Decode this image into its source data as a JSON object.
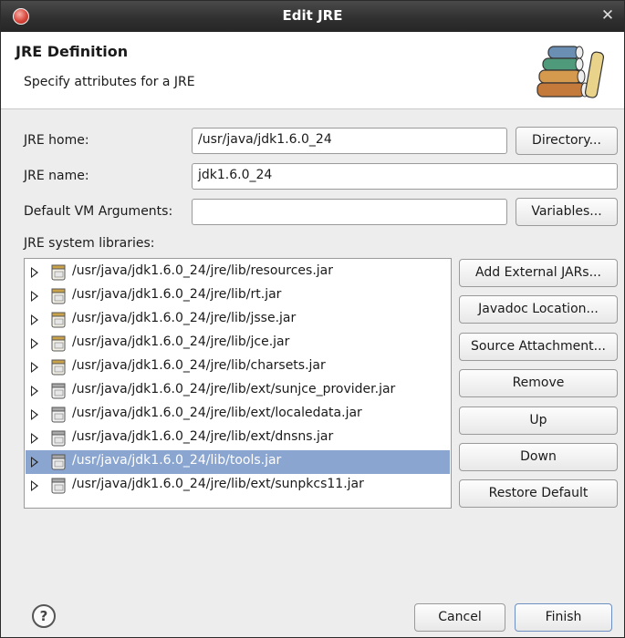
{
  "window": {
    "title": "Edit JRE"
  },
  "header": {
    "heading": "JRE Definition",
    "description": "Specify attributes for a JRE"
  },
  "form": {
    "jre_home_label": "JRE home:",
    "jre_home_value": "/usr/java/jdk1.6.0_24",
    "directory_button": "Directory...",
    "jre_name_label": "JRE name:",
    "jre_name_value": "jdk1.6.0_24",
    "vm_args_label": "Default VM Arguments:",
    "vm_args_value": "",
    "variables_button": "Variables...",
    "libraries_label": "JRE system libraries:"
  },
  "libraries": [
    {
      "path": "/usr/java/jdk1.6.0_24/jre/lib/resources.jar",
      "selected": false
    },
    {
      "path": "/usr/java/jdk1.6.0_24/jre/lib/rt.jar",
      "selected": false
    },
    {
      "path": "/usr/java/jdk1.6.0_24/jre/lib/jsse.jar",
      "selected": false
    },
    {
      "path": "/usr/java/jdk1.6.0_24/jre/lib/jce.jar",
      "selected": false
    },
    {
      "path": "/usr/java/jdk1.6.0_24/jre/lib/charsets.jar",
      "selected": false
    },
    {
      "path": "/usr/java/jdk1.6.0_24/jre/lib/ext/sunjce_provider.jar",
      "selected": false
    },
    {
      "path": "/usr/java/jdk1.6.0_24/jre/lib/ext/localedata.jar",
      "selected": false
    },
    {
      "path": "/usr/java/jdk1.6.0_24/jre/lib/ext/dnsns.jar",
      "selected": false
    },
    {
      "path": "/usr/java/jdk1.6.0_24/lib/tools.jar",
      "selected": true
    },
    {
      "path": "/usr/java/jdk1.6.0_24/jre/lib/ext/sunpkcs11.jar",
      "selected": false
    }
  ],
  "library_buttons": {
    "add_external_jars": "Add External JARs...",
    "javadoc_location": "Javadoc Location...",
    "source_attachment": "Source Attachment...",
    "remove": "Remove",
    "up": "Up",
    "down": "Down",
    "restore_default": "Restore Default"
  },
  "footer": {
    "help_glyph": "?",
    "cancel": "Cancel",
    "finish": "Finish"
  },
  "icons": {
    "app": "eclipse-icon",
    "close": "close-icon",
    "banner": "library-books-icon",
    "jar": "jar-file-icon",
    "expand": "expand-triangle-icon",
    "help": "help-icon"
  },
  "colors": {
    "titlebar": "#2f2f2f",
    "selection": "#8aa5cf",
    "dialog_background": "#ededed"
  }
}
